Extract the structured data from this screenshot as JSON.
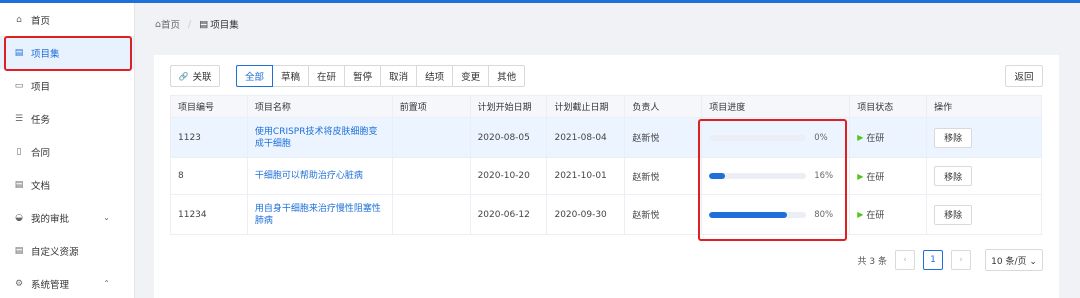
{
  "sidebar": {
    "items": [
      {
        "icon": "home-icon",
        "glyph": "⌂",
        "label": "首页"
      },
      {
        "icon": "project-set-icon",
        "glyph": "▤",
        "label": "项目集"
      },
      {
        "icon": "project-icon",
        "glyph": "▭",
        "label": "项目"
      },
      {
        "icon": "task-icon",
        "glyph": "☰",
        "label": "任务"
      },
      {
        "icon": "contract-icon",
        "glyph": "▯",
        "label": "合同"
      },
      {
        "icon": "document-icon",
        "glyph": "▤",
        "label": "文档"
      },
      {
        "icon": "approval-icon",
        "glyph": "◒",
        "label": "我的审批",
        "chevron": "⌄"
      },
      {
        "icon": "custom-resource-icon",
        "glyph": "▤",
        "label": "自定义资源"
      },
      {
        "icon": "settings-icon",
        "glyph": "⚙",
        "label": "系统管理",
        "chevron": "⌃"
      }
    ]
  },
  "breadcrumb": {
    "home_glyph": "⌂",
    "home": "首页",
    "sep": "/",
    "current_glyph": "▤",
    "current": "项目集"
  },
  "toolbar": {
    "link_glyph": "🔗",
    "link_label": "关联",
    "tabs": [
      "全部",
      "草稿",
      "在研",
      "暂停",
      "取消",
      "结项",
      "变更",
      "其他"
    ],
    "back_label": "返回"
  },
  "table": {
    "headers": [
      "项目编号",
      "项目名称",
      "前置项",
      "计划开始日期",
      "计划截止日期",
      "负责人",
      "项目进度",
      "项目状态",
      "操作"
    ],
    "rows": [
      {
        "id": "1123",
        "name": "使用CRISPR技术将皮肤细胞变成干细胞",
        "prereq": "",
        "start": "2020-08-05",
        "end": "2021-08-04",
        "owner": "赵新悦",
        "progress": 0,
        "progress_label": "0%",
        "status": "在研",
        "action": "移除"
      },
      {
        "id": "8",
        "name": "干细胞可以帮助治疗心脏病",
        "prereq": "",
        "start": "2020-10-20",
        "end": "2021-10-01",
        "owner": "赵新悦",
        "progress": 16,
        "progress_label": "16%",
        "status": "在研",
        "action": "移除"
      },
      {
        "id": "11234",
        "name": "用自身干细胞来治疗慢性阻塞性肺病",
        "prereq": "",
        "start": "2020-06-12",
        "end": "2020-09-30",
        "owner": "赵新悦",
        "progress": 80,
        "progress_label": "80%",
        "status": "在研",
        "action": "移除"
      }
    ]
  },
  "pager": {
    "total": "共 3 条",
    "prev": "‹",
    "page": "1",
    "next": "›",
    "size": "10 条/页 ⌄"
  },
  "colors": {
    "accent": "#1e6fd9",
    "status_green": "#52c41a",
    "highlight_red": "#e02020"
  }
}
